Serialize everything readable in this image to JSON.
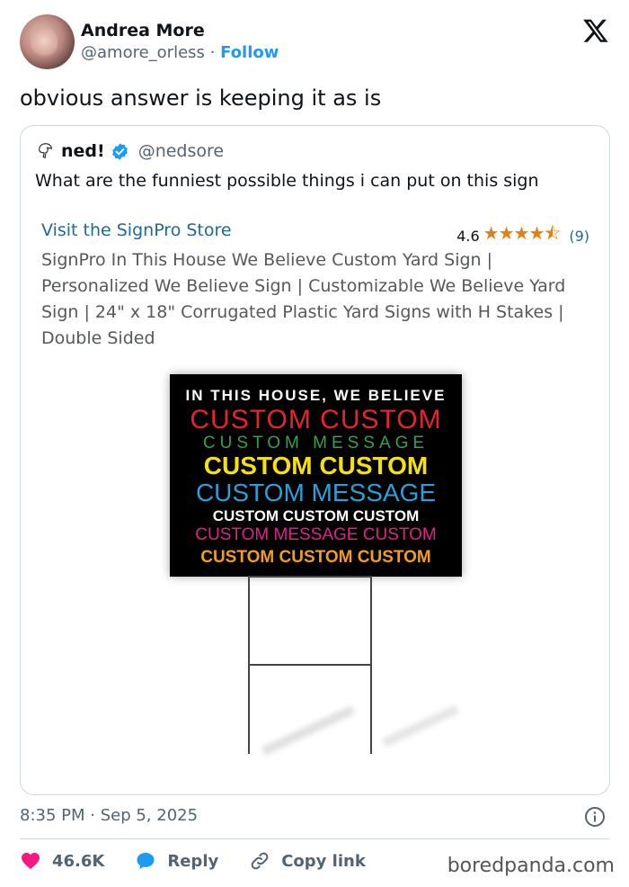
{
  "author": {
    "name": "Andrea More",
    "handle": "@amore_orless",
    "separator": "·",
    "follow_label": "Follow"
  },
  "tweet_text": "obvious answer is keeping it as is",
  "quoted": {
    "name": "ned!",
    "handle": "@nedsore",
    "text": "What are the funniest possible things i can put on this sign",
    "product": {
      "store_link": "Visit the SignPro Store",
      "rating_value": "4.6",
      "stars": "★★★★⯪",
      "rating_count": "(9)",
      "title": "SignPro In This House We Believe Custom Yard Sign | Personalized We Believe Sign | Customizable We Believe Yard Sign | 24\" x 18\" Corrugated Plastic Yard Signs with H Stakes | Double Sided"
    },
    "sign_lines": [
      {
        "text": "IN THIS HOUSE, WE BELIEVE",
        "color": "#ffffff"
      },
      {
        "text": "CUSTOM CUSTOM",
        "color": "#e8232a"
      },
      {
        "text": "CUSTOM MESSAGE",
        "color": "#2ea44f"
      },
      {
        "text": "CUSTOM CUSTOM",
        "color": "#f7e10b"
      },
      {
        "text": "CUSTOM MESSAGE",
        "color": "#2a9fd8"
      },
      {
        "text": "CUSTOM CUSTOM CUSTOM",
        "color": "#ffffff"
      },
      {
        "text": "CUSTOM MESSAGE CUSTOM",
        "color": "#e0218a"
      },
      {
        "text": "CUSTOM CUSTOM CUSTOM",
        "color": "#f39c1e"
      }
    ]
  },
  "timestamp": "8:35 PM · Sep 5, 2025",
  "actions": {
    "likes": "46.6K",
    "reply": "Reply",
    "copy_link": "Copy link"
  },
  "watermark": "boredpanda.com",
  "colors": {
    "accent": "#1d9bf0",
    "like": "#f91880",
    "text_secondary": "#536471",
    "amazon_link": "#1b6b98",
    "star": "#e57d11"
  }
}
